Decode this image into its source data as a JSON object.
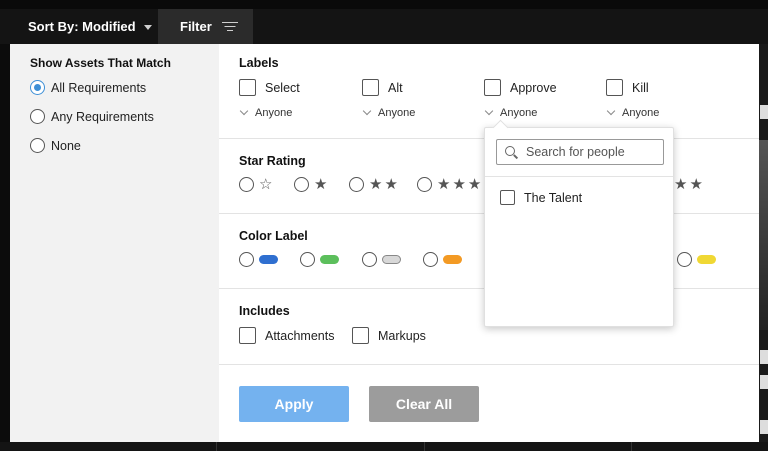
{
  "toolbar": {
    "sort_label": "Sort By: Modified",
    "filter_label": "Filter"
  },
  "match": {
    "title": "Show Assets That Match",
    "options": [
      {
        "label": "All Requirements",
        "selected": true
      },
      {
        "label": "Any Requirements",
        "selected": false
      },
      {
        "label": "None",
        "selected": false
      }
    ]
  },
  "labels": {
    "title": "Labels",
    "items": [
      {
        "label": "Select",
        "assignee": "Anyone"
      },
      {
        "label": "Alt",
        "assignee": "Anyone"
      },
      {
        "label": "Approve",
        "assignee": "Anyone"
      },
      {
        "label": "Kill",
        "assignee": "Anyone"
      }
    ]
  },
  "star_rating": {
    "title": "Star Rating",
    "options": [
      "☆",
      "★",
      "★★",
      "★★★",
      "★★"
    ]
  },
  "color_label": {
    "title": "Color Label",
    "colors": [
      "#2f6fd0",
      "#5cbf5c",
      "#d8d8d8",
      "#f39a24",
      "#f0d834"
    ]
  },
  "includes": {
    "title": "Includes",
    "items": [
      "Attachments",
      "Markups"
    ]
  },
  "actions": {
    "apply_label": "Apply",
    "clear_label": "Clear All"
  },
  "people_dropdown": {
    "search_placeholder": "Search for people",
    "people": [
      "The Talent"
    ]
  }
}
